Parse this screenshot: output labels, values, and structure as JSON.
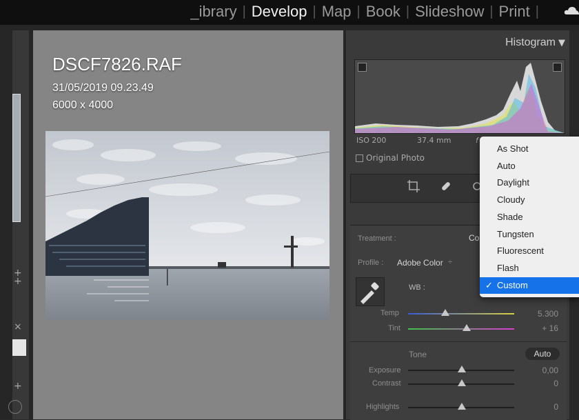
{
  "modules": {
    "library": "_ibrary",
    "develop": "Develop",
    "map": "Map",
    "book": "Book",
    "slideshow": "Slideshow",
    "print": "Print"
  },
  "photo_info": {
    "filename": "DSCF7826.RAF",
    "datetime": "31/05/2019 09.23.49",
    "dimensions": "6000 x 4000"
  },
  "histogram": {
    "title": "Histogram",
    "iso": "ISO 200",
    "focal": "37.4 mm",
    "aperture_glyph": "f",
    "original_photo": "Original Photo"
  },
  "basic": {
    "treatment_label": "Treatment :",
    "treatment_value": "Col",
    "profile_label": "Profile :",
    "profile_value": "Adobe Color",
    "wb_label": "WB :",
    "temp_label": "Temp",
    "temp_value": "5.300",
    "temp_level": 0.35,
    "tint_label": "Tint",
    "tint_value": "+ 16",
    "tint_level": 0.55,
    "tone_label": "Tone",
    "auto_label": "Auto",
    "exposure_label": "Exposure",
    "exposure_value": "0,00",
    "contrast_label": "Contrast",
    "contrast_value": "0",
    "highlights_label": "Highlights",
    "highlights_value": "0"
  },
  "wb_menu": {
    "items": [
      "As Shot",
      "Auto",
      "Daylight",
      "Cloudy",
      "Shade",
      "Tungsten",
      "Fluorescent",
      "Flash",
      "Custom"
    ],
    "selected": "Custom",
    "check": "✓"
  },
  "left_glyphs": {
    "plus1": "+",
    "plus2": "+",
    "x": "×",
    "plus3": "+"
  },
  "colors": {
    "accent": "#1572e8",
    "temp_gradient_start": "#3b5bd6",
    "temp_gradient_end": "#d8d240",
    "tint_gradient_start": "#3fc24a",
    "tint_gradient_end": "#d63fd0"
  }
}
